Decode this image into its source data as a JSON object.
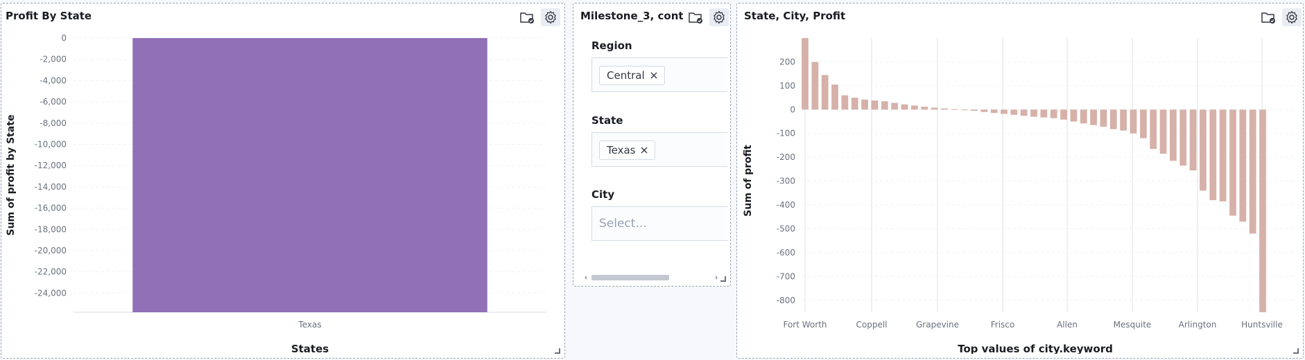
{
  "panels": {
    "left": {
      "title": "Profit By State"
    },
    "controls": {
      "title": "Milestone_3, cont...",
      "region": {
        "label": "Region",
        "value": "Central"
      },
      "state": {
        "label": "State",
        "value": "Texas"
      },
      "city": {
        "label": "City",
        "placeholder": "Select..."
      }
    },
    "right": {
      "title": "State, City, Profit"
    }
  },
  "icons": {
    "folder": "folder-check-icon",
    "gear": "gear-icon",
    "remove": "close-icon"
  },
  "chart_data": [
    {
      "type": "bar",
      "xlabel": "States",
      "ylabel": "Sum of profit by State",
      "categories": [
        "Texas"
      ],
      "values": [
        -25800
      ],
      "ylim": [
        -25800,
        0
      ],
      "yticks": [
        0,
        -2000,
        -4000,
        -6000,
        -8000,
        -10000,
        -12000,
        -14000,
        -16000,
        -18000,
        -20000,
        -22000,
        -24000
      ],
      "ytick_labels": [
        "0",
        "-2,000",
        "-4,000",
        "-6,000",
        "-8,000",
        "-10,000",
        "-12,000",
        "-14,000",
        "-16,000",
        "-18,000",
        "-20,000",
        "-22,000",
        "-24,000"
      ],
      "color": "#9170b8",
      "grid": true
    },
    {
      "type": "bar",
      "xlabel": "Top values of city.keyword",
      "ylabel": "Sum of profit",
      "visible_categories": [
        "Fort Worth",
        "Coppell",
        "Grapevine",
        "Frisco",
        "Allen",
        "Mesquite",
        "Arlington",
        "Huntsville"
      ],
      "values": [
        300,
        200,
        145,
        105,
        60,
        50,
        42,
        38,
        35,
        28,
        22,
        17,
        12,
        8,
        5,
        2,
        -2,
        -5,
        -10,
        -14,
        -18,
        -22,
        -26,
        -30,
        -33,
        -36,
        -42,
        -50,
        -58,
        -65,
        -72,
        -82,
        -88,
        -100,
        -120,
        -165,
        -185,
        -215,
        -235,
        -255,
        -340,
        -380,
        -385,
        -445,
        -470,
        -520,
        -850
      ],
      "ylim": [
        -850,
        300
      ],
      "yticks": [
        200,
        100,
        0,
        -100,
        -200,
        -300,
        -400,
        -500,
        -600,
        -700,
        -800
      ],
      "color": "#d6b1a9",
      "grid": true
    }
  ]
}
